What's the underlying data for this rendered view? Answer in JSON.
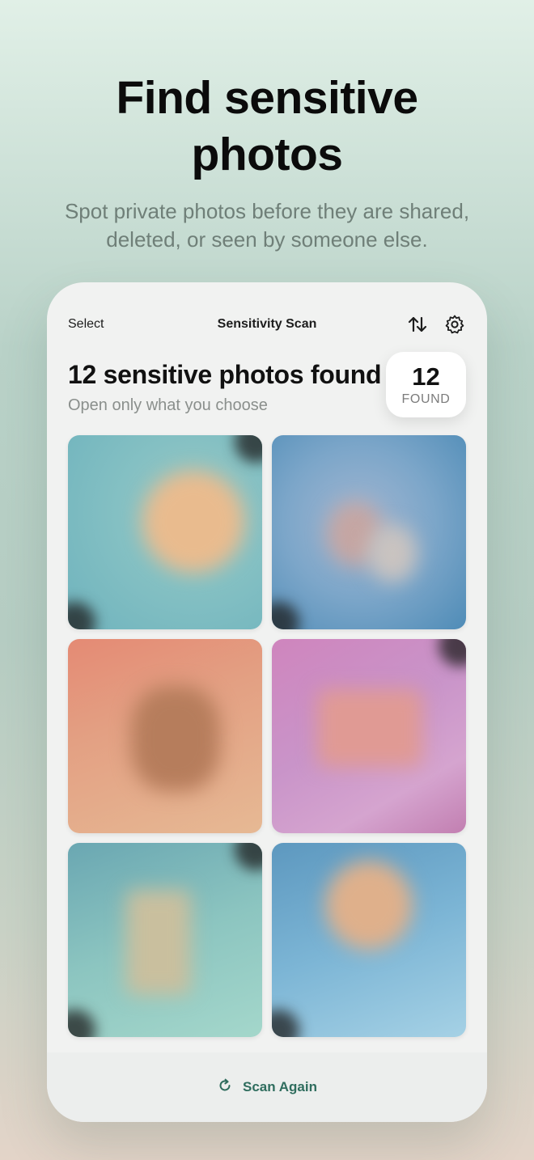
{
  "hero": {
    "title_line1": "Find sensitive",
    "title_line2": "photos",
    "subtitle_line1": "Spot private photos before they are shared,",
    "subtitle_line2": "deleted, or seen by someone else."
  },
  "nav": {
    "select_label": "Select",
    "title": "Sensitivity Scan",
    "sort_icon": "sort-arrows-icon",
    "settings_icon": "gear-icon"
  },
  "summary": {
    "title": "12 sensitive photos found",
    "subtitle": "Open only what you choose",
    "badge_count": "12",
    "badge_label": "FOUND"
  },
  "photos": [
    {
      "style": "teal-blurred"
    },
    {
      "style": "blue-blurred"
    },
    {
      "style": "peach-blurred"
    },
    {
      "style": "pink-blurred"
    },
    {
      "style": "mint-blurred"
    },
    {
      "style": "sky-blurred"
    }
  ],
  "footer": {
    "scan_again_label": "Scan Again",
    "scan_icon": "refresh-icon"
  },
  "colors": {
    "accent": "#2f6d5e",
    "card_bg": "#f1f2f1"
  }
}
